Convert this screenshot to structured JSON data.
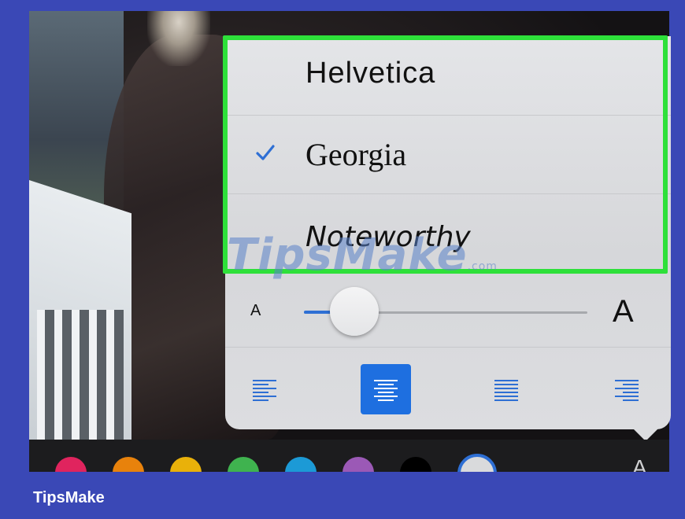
{
  "fonts": {
    "items": [
      {
        "label": "Helvetica",
        "selected": false
      },
      {
        "label": "Georgia",
        "selected": true
      },
      {
        "label": "Noteworthy",
        "selected": false
      }
    ]
  },
  "size_slider": {
    "small_label": "A",
    "large_label": "A",
    "level_percent": 15
  },
  "alignment": {
    "options": [
      "align-left-icon",
      "align-center-icon",
      "justify-icon",
      "align-right-icon"
    ],
    "selected": "align-center-icon"
  },
  "toolbar": {
    "colors": [
      "#e0245e",
      "#e8820c",
      "#e9b10a",
      "#3fb34f",
      "#1c9ad6",
      "#9b59b6",
      "#000000",
      "#d9dadc"
    ],
    "selected_color_index": 7,
    "format_label": "A"
  },
  "watermark": {
    "text": "TipsMake",
    "suffix": ".com"
  },
  "brand": {
    "name": "TipsMake"
  },
  "accent_color": "#1e6fe0",
  "highlight_color": "#2ee03a"
}
